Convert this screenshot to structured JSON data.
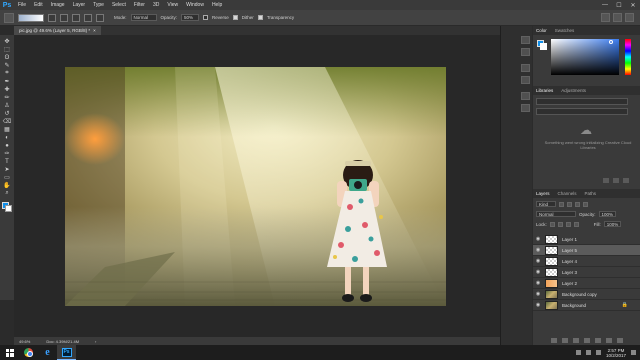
{
  "app": {
    "logo_text": "Ps"
  },
  "menu": [
    "File",
    "Edit",
    "Image",
    "Layer",
    "Type",
    "Select",
    "Filter",
    "3D",
    "View",
    "Window",
    "Help"
  ],
  "window_controls": {
    "minimize": "—",
    "maximize": "☐",
    "close": "✕"
  },
  "options_bar": {
    "mode_label": "Mode:",
    "mode_value": "Normal",
    "opacity_label": "Opacity:",
    "opacity_value": "50%",
    "reverse_label": "Reverse",
    "dither_label": "Dither",
    "transparency_label": "Transparency",
    "reverse_checked": false,
    "dither_checked": true,
    "transparency_checked": true
  },
  "document": {
    "tab_title": "pic.jpg @ 49.6% (Layer 5, RGB/8) *",
    "close_glyph": "×",
    "zoom": "49.6%",
    "doc_info": "Doc: 4.39M/21.4M",
    "status_arrow": "›"
  },
  "toolbar": {
    "tools": [
      "move-tool",
      "marquee-tool",
      "lasso-tool",
      "quick-select-tool",
      "crop-tool",
      "eyedropper-tool",
      "healing-brush-tool",
      "brush-tool",
      "clone-stamp-tool",
      "history-brush-tool",
      "eraser-tool",
      "gradient-tool",
      "blur-tool",
      "dodge-tool",
      "pen-tool",
      "type-tool",
      "path-select-tool",
      "shape-tool",
      "hand-tool",
      "zoom-tool"
    ],
    "glyphs": [
      "✥",
      "⬚",
      "ʘ",
      "✎",
      "⌗",
      "✒",
      "✚",
      "✏",
      "♙",
      "↺",
      "⌫",
      "▦",
      "◐",
      "●",
      "✑",
      "T",
      "➤",
      "▭",
      "✋",
      "⌕"
    ],
    "foreground_color": "#0f8ee9",
    "background_color": "#ffffff"
  },
  "color_panel": {
    "tab_color": "Color",
    "tab_swatches": "Swatches",
    "hue": "#3c7df0"
  },
  "libraries_panel": {
    "tab_libraries": "Libraries",
    "tab_adjustments": "Adjustments",
    "cloud_glyph": "☁",
    "message": "Something went wrong initializing Creative Cloud Libraries"
  },
  "layers_panel": {
    "tab_layers": "Layers",
    "tab_channels": "Channels",
    "tab_paths": "Paths",
    "kind_label": "Kind",
    "blend_mode": "Normal",
    "opacity_label": "Opacity:",
    "opacity_value": "100%",
    "lock_label": "Lock:",
    "fill_label": "Fill:",
    "fill_value": "100%",
    "eye_glyph": "◉",
    "lock_glyph": "🔒",
    "layers": [
      {
        "name": "Layer 1",
        "thumb": "check",
        "selected": false,
        "locked": false
      },
      {
        "name": "Layer 5",
        "thumb": "check",
        "selected": true,
        "locked": false
      },
      {
        "name": "Layer 4",
        "thumb": "check",
        "selected": false,
        "locked": false
      },
      {
        "name": "Layer 3",
        "thumb": "check",
        "selected": false,
        "locked": false
      },
      {
        "name": "Layer 2",
        "thumb": "orange",
        "selected": false,
        "locked": false
      },
      {
        "name": "Background copy",
        "thumb": "photo-t",
        "selected": false,
        "locked": false
      },
      {
        "name": "Background",
        "thumb": "photo-t",
        "selected": false,
        "locked": true
      }
    ]
  },
  "taskbar": {
    "time": "2:57 PM",
    "date": "10/2/2017",
    "ie_glyph": "e",
    "ps_glyph": "Ps"
  }
}
